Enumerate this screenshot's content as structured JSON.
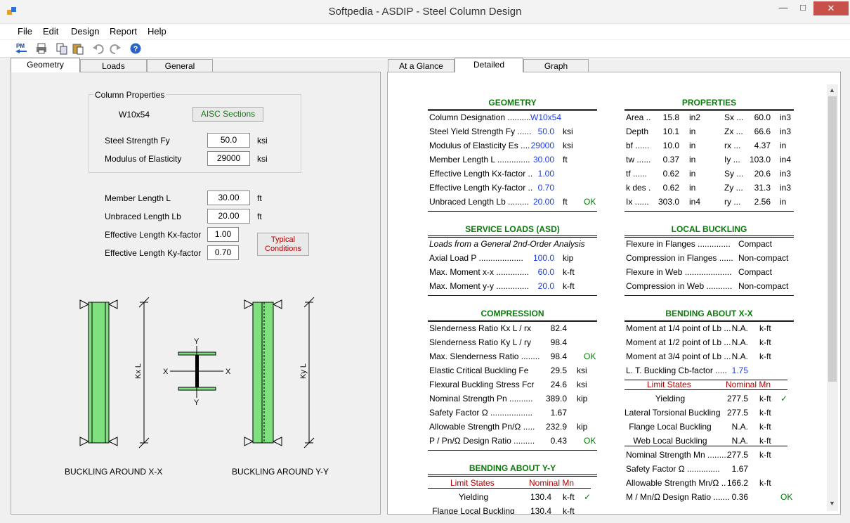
{
  "window": {
    "title": "Softpedia  - ASDIP - Steel Column Design"
  },
  "menu": [
    "File",
    "Edit",
    "Design",
    "Report",
    "Help"
  ],
  "toolbar": {
    "icons": [
      "pm-back-icon",
      "print-icon",
      "copy-icon",
      "paste-icon",
      "undo-icon",
      "redo-icon",
      "help-icon"
    ],
    "pm_label": "PM"
  },
  "left_tabs": [
    "Geometry",
    "Loads",
    "General"
  ],
  "right_tabs": [
    "At a Glance",
    "Detailed",
    "Graph"
  ],
  "geometry": {
    "group_title": "Column Properties",
    "section": "W10x54",
    "aisc_button": "AISC Sections",
    "fy_label": "Steel Strength  Fy",
    "fy": "50.0",
    "fy_unit": "ksi",
    "e_label": "Modulus of Elasticity",
    "e": "29000",
    "e_unit": "ksi",
    "l_label": "Member Length  L",
    "l": "30.00",
    "l_unit": "ft",
    "lb_label": "Unbraced Length  Lb",
    "lb": "20.00",
    "lb_unit": "ft",
    "kx_label": "Effective Length Kx-factor",
    "kx": "1.00",
    "ky_label": "Effective Length Ky-factor",
    "ky": "0.70",
    "typical_button": "Typical\nConditions",
    "caption_xx": "BUCKLING AROUND X-X",
    "caption_yy": "BUCKLING AROUND Y-Y",
    "kxl": "Kx L",
    "kyl": "Ky L",
    "axis_x": "X",
    "axis_y": "Y"
  },
  "report": {
    "geometry_title": "GEOMETRY",
    "geometry_rows": [
      [
        "Column Designation ..........",
        "W10x54",
        "",
        ""
      ],
      [
        "Steel Yield Strength  Fy  ......",
        "50.0",
        "ksi",
        ""
      ],
      [
        "Modulus of Elasticity  Es  ....",
        "29000",
        "ksi",
        ""
      ],
      [
        "Member Length  L  ..............",
        "30.00",
        "ft",
        ""
      ],
      [
        "Effective Length  Kx-factor  ..",
        "1.00",
        "",
        ""
      ],
      [
        "Effective Length  Ky-factor  ..",
        "0.70",
        "",
        ""
      ],
      [
        "Unbraced Length  Lb  .........",
        "20.00",
        "ft",
        "OK"
      ]
    ],
    "properties_title": "PROPERTIES",
    "properties_rows": [
      [
        "Area  ..",
        "15.8",
        "in2",
        "Sx  ...",
        "60.0",
        "in3"
      ],
      [
        "Depth",
        "10.1",
        "in",
        "Zx  ...",
        "66.6",
        "in3"
      ],
      [
        "bf  ......",
        "10.0",
        "in",
        "rx  ...",
        "4.37",
        "in"
      ],
      [
        "tw  ......",
        "0.37",
        "in",
        "Iy  ...",
        "103.0",
        "in4"
      ],
      [
        "tf  ......",
        "0.62",
        "in",
        "Sy  ...",
        "20.6",
        "in3"
      ],
      [
        "k des  .",
        "0.62",
        "in",
        "Zy  ...",
        "31.3",
        "in3"
      ],
      [
        "Ix  ......",
        "303.0",
        "in4",
        "ry  ...",
        "2.56",
        "in"
      ]
    ],
    "service_title": "SERVICE LOADS (ASD)",
    "service_note": "Loads from a General 2nd-Order Analysis",
    "service_rows": [
      [
        "Axial Load  P  ...................",
        "100.0",
        "kip"
      ],
      [
        "Max. Moment x-x  ..............",
        "60.0",
        "k-ft"
      ],
      [
        "Max. Moment y-y  ..............",
        "20.0",
        "k-ft"
      ]
    ],
    "local_title": "LOCAL BUCKLING",
    "local_rows": [
      [
        "Flexure in Flanges  ..............",
        "Compact"
      ],
      [
        "Compression in Flanges  ......",
        "Non-compact"
      ],
      [
        "Flexure in Web  ....................",
        "Compact"
      ],
      [
        "Compression in Web  ...........",
        "Non-compact"
      ]
    ],
    "compression_title": "COMPRESSION",
    "compression_rows": [
      [
        "Slenderness Ratio  Kx L / rx",
        "82.4",
        "",
        ""
      ],
      [
        "Slenderness Ratio  Ky L / ry",
        "98.4",
        "",
        ""
      ],
      [
        "Max. Slenderness Ratio  ........",
        "98.4",
        "",
        "OK"
      ],
      [
        "Elastic Critical Buckling  Fe",
        "29.5",
        "ksi",
        ""
      ],
      [
        "Flexural Buckling Stress  Fcr",
        "24.6",
        "ksi",
        ""
      ],
      [
        "Nominal Strength  Pn  ..........",
        "389.0",
        "kip",
        ""
      ],
      [
        "Safety Factor  Ω  ..................",
        "1.67",
        "",
        ""
      ],
      [
        "Allowable Strength  Pn/Ω  .....",
        "232.9",
        "kip",
        ""
      ],
      [
        "P / Pn/Ω Design Ratio  .........",
        "0.43",
        "",
        "OK"
      ]
    ],
    "bendx_title": "BENDING ABOUT X-X",
    "bendx_rows": [
      [
        "Moment at 1/4 point of Lb  ...",
        "N.A.",
        "k-ft",
        ""
      ],
      [
        "Moment at 1/2 point of Lb  ...",
        "N.A.",
        "k-ft",
        ""
      ],
      [
        "Moment at 3/4 point of Lb  ...",
        "N.A.",
        "k-ft",
        ""
      ],
      [
        "L. T. Buckling Cb-factor  .....",
        "1.75",
        "",
        ""
      ]
    ],
    "limit_header": [
      "Limit States",
      "Nominal Mn"
    ],
    "limit_rows": [
      [
        "Yielding",
        "277.5",
        "k-ft",
        "✓"
      ],
      [
        "Lateral Torsional Buckling",
        "277.5",
        "k-ft",
        ""
      ],
      [
        "Flange Local Buckling",
        "N.A.",
        "k-ft",
        ""
      ],
      [
        "Web Local Buckling",
        "N.A.",
        "k-ft",
        ""
      ]
    ],
    "bendx_rows2": [
      [
        "Nominal Strength  Mn  .........",
        "277.5",
        "k-ft",
        ""
      ],
      [
        "Safety Factor  Ω  ..............",
        "1.67",
        "",
        ""
      ],
      [
        "Allowable Strength  Mn/Ω  ..",
        "166.2",
        "k-ft",
        ""
      ],
      [
        "M / Mn/Ω Design Ratio  .......",
        "0.36",
        "",
        "OK"
      ]
    ],
    "bendy_title": "BENDING ABOUT Y-Y",
    "bendy_rows": [
      [
        "Yielding",
        "130.4",
        "k-ft",
        "✓"
      ],
      [
        "Flange Local Buckling",
        "130.4",
        "k-ft",
        ""
      ]
    ]
  },
  "colors": {
    "accent_blue": "#1f3de0",
    "ok_green": "#007a00",
    "title_green": "#0c7a0c",
    "limit_red": "#b00000",
    "member_green": "#7fe07f"
  }
}
